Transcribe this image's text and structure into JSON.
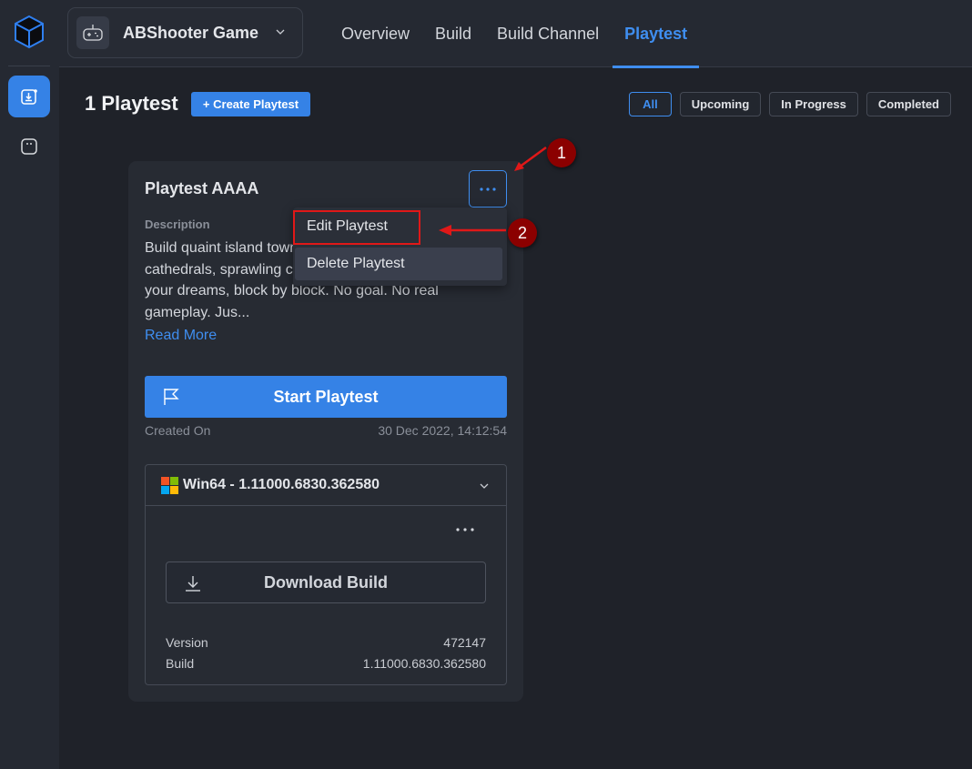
{
  "sidebar": {
    "logo": "cube-logo-icon",
    "items": [
      {
        "name": "builds-icon",
        "active": true
      },
      {
        "name": "game-console-icon",
        "active": false
      }
    ]
  },
  "header": {
    "game_name": "ABShooter Game",
    "tabs": [
      {
        "label": "Overview",
        "active": false
      },
      {
        "label": "Build",
        "active": false
      },
      {
        "label": "Build Channel",
        "active": false
      },
      {
        "label": "Playtest",
        "active": true
      }
    ]
  },
  "page": {
    "title": "1 Playtest",
    "create_button": "+ Create Playtest",
    "filters": [
      {
        "label": "All",
        "active": true
      },
      {
        "label": "Upcoming",
        "active": false
      },
      {
        "label": "In Progress",
        "active": false
      },
      {
        "label": "Completed",
        "active": false
      }
    ]
  },
  "card": {
    "title": "Playtest AAAA",
    "description_label": "Description",
    "description": "Build quaint island towns, rolling hamlets, soaring cathedrals, sprawling cities on stilts. Build the town of your dreams, block by block. No goal. No real gameplay. Jus...",
    "read_more": "Read More",
    "start_button": "Start Playtest",
    "created_label": "Created On",
    "created_value": "30 Dec 2022, 14:12:54",
    "build": {
      "platform": "Win64",
      "title": "Win64 - 1.11000.6830.362580",
      "download_button": "Download Build",
      "version_label": "Version",
      "version_value": "472147",
      "build_label": "Build",
      "build_value": "1.11000.6830.362580"
    }
  },
  "menu": {
    "items": [
      "Edit Playtest",
      "Delete Playtest"
    ]
  },
  "annotations": {
    "callout_1": "1",
    "callout_2": "2"
  },
  "colors": {
    "accent": "#3582e6",
    "highlight": "#e01818",
    "callout": "#8b0000"
  }
}
